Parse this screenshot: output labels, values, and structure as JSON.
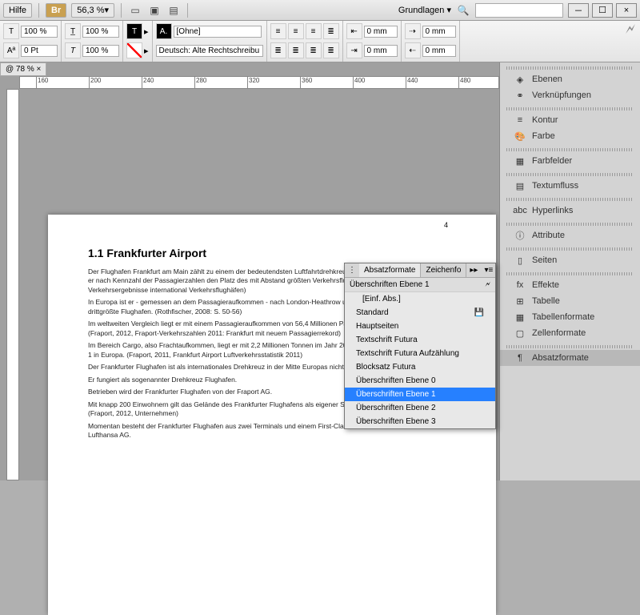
{
  "topbar": {
    "help": "Hilfe",
    "bridge": "Br",
    "zoom": "56,3 %",
    "basics": "Grundlagen",
    "min": "－",
    "max": "☐",
    "close": "×"
  },
  "toolbar": {
    "pct1": "100 %",
    "pct2": "100 %",
    "pt": "0 Pt",
    "style": "[Ohne]",
    "lang": "Deutsch: Alte Rechtschreibu",
    "mm": "0 mm"
  },
  "zoomTab": "@ 78 %",
  "rulerTicks": [
    "160",
    "200",
    "240",
    "280",
    "320",
    "360",
    "400",
    "440",
    "480"
  ],
  "doc": {
    "pageNum": "4",
    "heading": "1.1 Frankfurter Airport",
    "p1": "Der Flughafen Frankfurt am Main zählt zu einem der bedeutendsten Luftfahrtdrehkreuze der Welt. In Deutschland nimmt er nach Kennzahl der Passagierzahlen den Platz des mit Abstand größten Verkehrsflughafens ein. (ADV, 2007, Verkehrsergebnisse international Verkehrsflughäfen)",
    "p2": "In Europa ist er - gemessen an dem Passagieraufkommen - nach London-Heathrow und Paris-Charles de Gaulle der drittgrößte Flughafen. (Rothfischer, 2008: S. 50-56)",
    "p3": "Im weltweiten Vergleich liegt er mit einem Passagieraufkommen von 56,4 Millionen Passagieren im Jahr 2011 auf Platz 9. (Fraport, 2012, Fraport-Verkehrszahlen 2011: Frankfurt mit neuem Passagierrekord)",
    "p4": "Im Bereich Cargo, also Frachtaufkommen, liegt er mit 2,2 Millionen Tonnen im Jahr 2010 auf Platz 7 weltweit und auf Platz 1 in Europa. (Fraport, 2011, Frankfurt Airport Luftverkehrsstatistik 2011)",
    "p5": "Der Frankfurter Flughafen ist als internationales Drehkreuz in der Mitte Europas nicht mehr wegzudenken.",
    "p6": "Er fungiert als sogenannter Drehkreuz Flughafen.",
    "p7": "Betrieben wird der Frankfurter Flughafen von der Fraport AG.",
    "p8": "Mit knapp 200 Einwohnern gilt das Gelände des Frankfurter Flughafens als eigener Stadtteil von Frankfurt am Main. (Fraport, 2012, Unternehmen)",
    "p9": "Momentan besteht der Frankfurter Flughafen aus zwei Terminals und einem First-Class-Terminal der Deutschen Lufthansa AG."
  },
  "popup": {
    "tab1": "Absatzformate",
    "tab2": "Zeichenfo",
    "header": "Überschriften Ebene 1",
    "headerIcon": "🗲",
    "items": [
      {
        "label": "[Einf. Abs.]",
        "sel": false,
        "ind": true,
        "save": false
      },
      {
        "label": "Standard",
        "sel": false,
        "ind": false,
        "save": true
      },
      {
        "label": "Hauptseiten",
        "sel": false,
        "ind": false,
        "save": false
      },
      {
        "label": "Textschrift Futura",
        "sel": false,
        "ind": false,
        "save": false
      },
      {
        "label": "Textschrift Futura Aufzählung",
        "sel": false,
        "ind": false,
        "save": false
      },
      {
        "label": "Blocksatz Futura",
        "sel": false,
        "ind": false,
        "save": false
      },
      {
        "label": "Überschriften Ebene 0",
        "sel": false,
        "ind": false,
        "save": false
      },
      {
        "label": "Überschriften Ebene 1",
        "sel": true,
        "ind": false,
        "save": false
      },
      {
        "label": "Überschriften Ebene 2",
        "sel": false,
        "ind": false,
        "save": false
      },
      {
        "label": "Überschriften Ebene 3",
        "sel": false,
        "ind": false,
        "save": false
      }
    ]
  },
  "panels": [
    {
      "grp": true
    },
    {
      "icon": "◈",
      "label": "Ebenen"
    },
    {
      "icon": "⚭",
      "label": "Verknüpfungen"
    },
    {
      "grp": true
    },
    {
      "icon": "≡",
      "label": "Kontur"
    },
    {
      "icon": "🎨",
      "label": "Farbe"
    },
    {
      "grp": true
    },
    {
      "icon": "▦",
      "label": "Farbfelder"
    },
    {
      "grp": true
    },
    {
      "icon": "▤",
      "label": "Textumfluss"
    },
    {
      "grp": true
    },
    {
      "icon": "abc",
      "label": "Hyperlinks"
    },
    {
      "grp": true
    },
    {
      "icon": "ⓘ",
      "label": "Attribute"
    },
    {
      "grp": true
    },
    {
      "icon": "▯",
      "label": "Seiten"
    },
    {
      "grp": true
    },
    {
      "icon": "fx",
      "label": "Effekte"
    },
    {
      "icon": "⊞",
      "label": "Tabelle"
    },
    {
      "icon": "▦",
      "label": "Tabellenformate"
    },
    {
      "icon": "▢",
      "label": "Zellenformate"
    },
    {
      "grp": true
    },
    {
      "icon": "¶",
      "label": "Absatzformate",
      "active": true
    }
  ]
}
